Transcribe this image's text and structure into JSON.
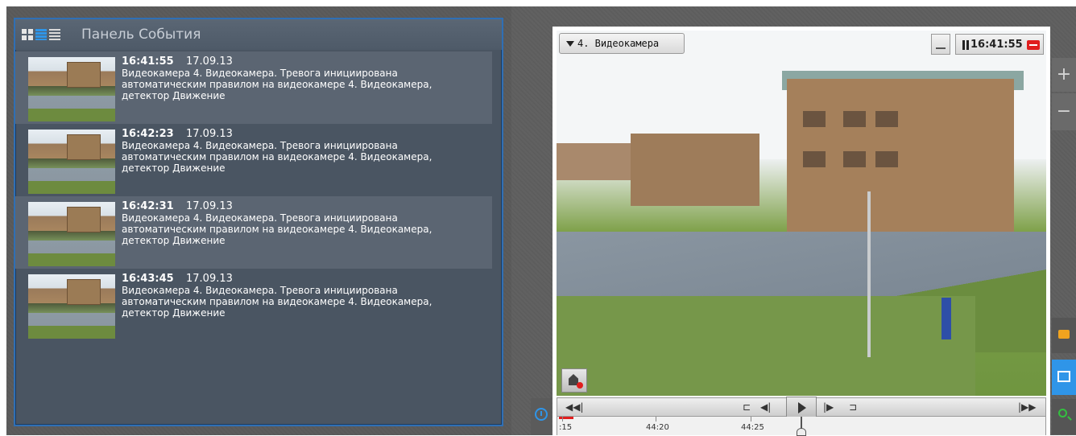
{
  "event_panel": {
    "title": "Панель События",
    "events": [
      {
        "time": "16:41:55",
        "date": "17.09.13",
        "text": "Видеокамера 4. Видеокамера. Тревога инициирована автоматическим правилом на видеокамере 4. Видеокамера, детектор Движение"
      },
      {
        "time": "16:42:23",
        "date": "17.09.13",
        "text": "Видеокамера 4. Видеокамера. Тревога инициирована автоматическим правилом на видеокамере 4. Видеокамера, детектор Движение"
      },
      {
        "time": "16:42:31",
        "date": "17.09.13",
        "text": "Видеокамера 4. Видеокамера. Тревога инициирована автоматическим правилом на видеокамере 4. Видеокамера, детектор Движение"
      },
      {
        "time": "16:43:45",
        "date": "17.09.13",
        "text": "Видеокамера 4. Видеокамера. Тревога инициирована автоматическим правилом на видеокамере 4. Видеокамера, детектор Движение"
      }
    ]
  },
  "camera": {
    "name": "4. Видеокамера",
    "time": "16:41:55",
    "zoom_in": "+",
    "zoom_out": "−"
  },
  "playback": {
    "first": "◀◀|",
    "to_start": "⊏",
    "step_back": "◀|",
    "step_fwd": "|▶",
    "to_end": "⊐",
    "last": "|▶▶"
  },
  "timeline": {
    "labels": [
      ":15",
      "44:20",
      "44:25"
    ]
  },
  "colors": {
    "accent": "#2f95e8",
    "rec": "#e01e1e",
    "panel_bg": "#4a5562"
  }
}
